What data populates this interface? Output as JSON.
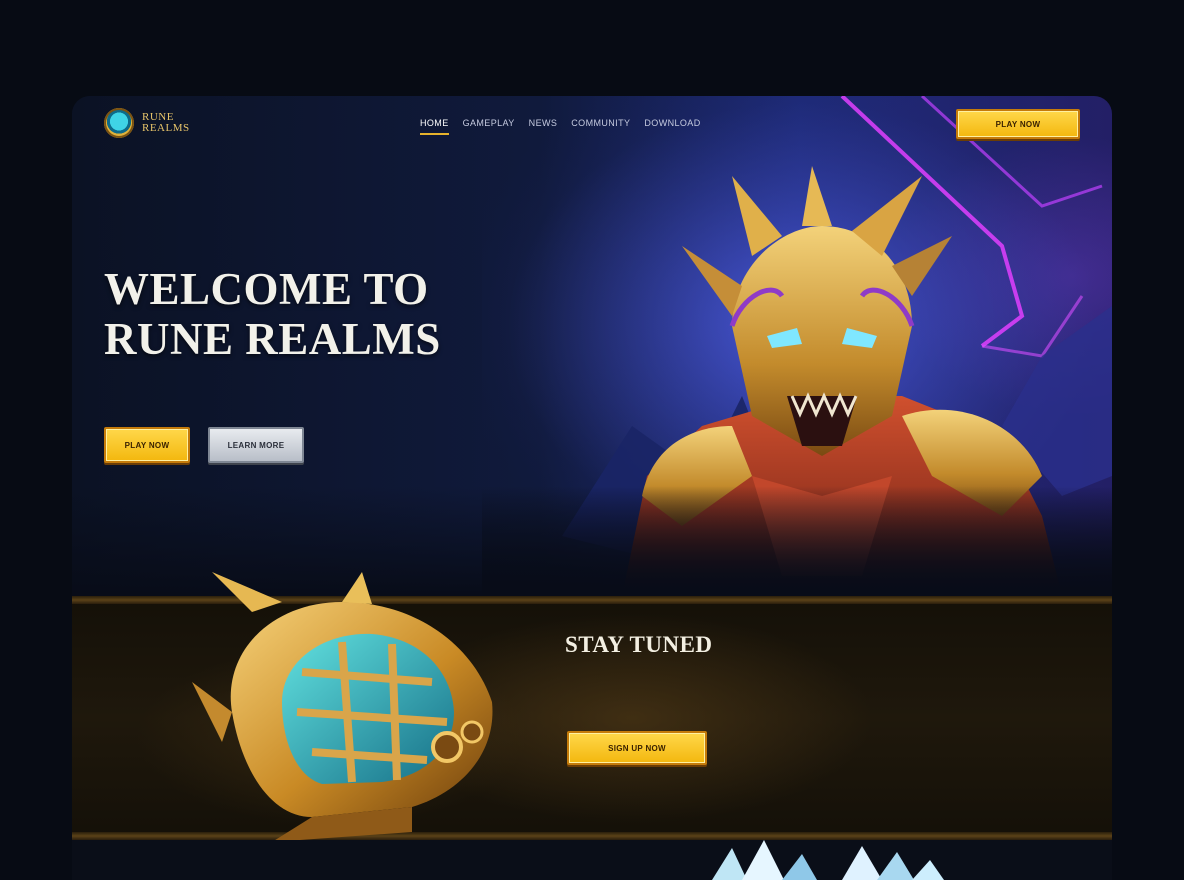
{
  "brand": {
    "name": "RUNE REALMS"
  },
  "nav": {
    "items": [
      {
        "label": "HOME",
        "active": true
      },
      {
        "label": "GAMEPLAY",
        "active": false
      },
      {
        "label": "NEWS",
        "active": false
      },
      {
        "label": "COMMUNITY",
        "active": false
      },
      {
        "label": "DOWNLOAD",
        "active": false
      }
    ],
    "cta_label": "PLAY NOW"
  },
  "hero": {
    "eyebrow": "",
    "title": "WELCOME TO RUNE REALMS",
    "description": "",
    "primary_button": "PLAY NOW",
    "secondary_button": "LEARN MORE"
  },
  "stay_tuned": {
    "title": "STAY TUNED",
    "text": "",
    "button": "SIGN UP NOW"
  },
  "colors": {
    "accent_gold": "#f3b70e",
    "background": "#070b14",
    "hero_blue": "#1d2a78",
    "band_brown": "#1f180c"
  }
}
